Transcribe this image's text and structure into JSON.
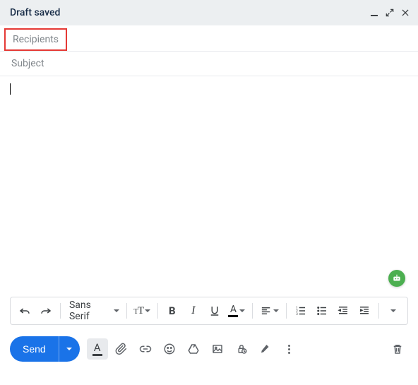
{
  "header": {
    "title": "Draft saved"
  },
  "fields": {
    "recipients_placeholder": "Recipients",
    "subject_placeholder": "Subject",
    "body_value": ""
  },
  "toolbar": {
    "font_family": "Sans Serif"
  },
  "actions": {
    "send_label": "Send"
  },
  "annotations": {
    "highlight_target": "recipients"
  }
}
